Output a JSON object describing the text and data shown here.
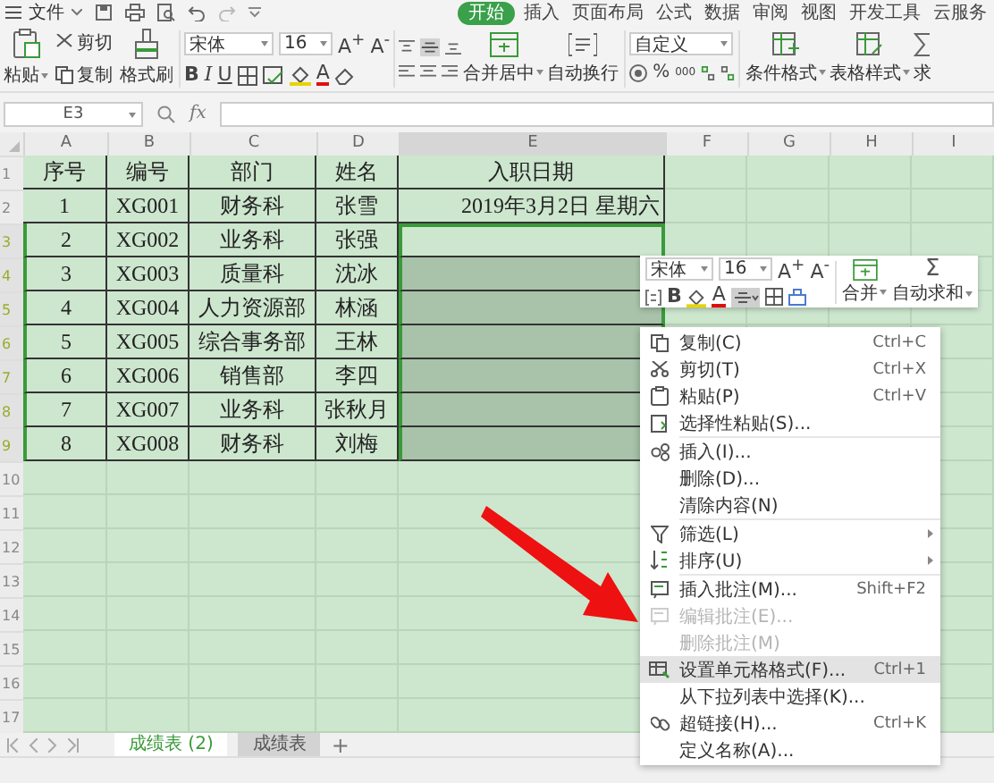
{
  "menu_bar": {
    "file": "文件",
    "tabs": [
      {
        "label": "开始",
        "selected": true
      },
      {
        "label": "插入",
        "selected": false
      },
      {
        "label": "页面布局",
        "selected": false
      },
      {
        "label": "公式",
        "selected": false
      },
      {
        "label": "数据",
        "selected": false
      },
      {
        "label": "审阅",
        "selected": false
      },
      {
        "label": "视图",
        "selected": false
      },
      {
        "label": "开发工具",
        "selected": false
      },
      {
        "label": "云服务",
        "selected": false
      }
    ]
  },
  "ribbon": {
    "paste": "粘贴",
    "cut": "剪切",
    "copy": "复制",
    "format_painter": "格式刷",
    "font": "宋体",
    "font_size": "16",
    "grow_font": "A$^{+}$",
    "shrink_font": "A$^{-}$",
    "bold": "B",
    "italic": "I",
    "underline": "U",
    "font_color": "A",
    "merge_center": "合并居中",
    "wrap_text": "自动换行",
    "number_format": "自定义",
    "percent": "%",
    "thousands": "000",
    "conditional_format": "条件格式",
    "table_style": "表格样式",
    "sum": "求"
  },
  "formula_bar": {
    "cell_ref": "E3",
    "fx": "fx"
  },
  "columns": [
    {
      "label": "A",
      "selected": false
    },
    {
      "label": "B",
      "selected": false
    },
    {
      "label": "C",
      "selected": false
    },
    {
      "label": "D",
      "selected": false
    },
    {
      "label": "E",
      "selected": true
    },
    {
      "label": "F",
      "selected": false
    },
    {
      "label": "G",
      "selected": false
    },
    {
      "label": "H",
      "selected": false
    },
    {
      "label": "I",
      "selected": false
    }
  ],
  "rows": [
    {
      "num": "1",
      "selected": false,
      "cells": [
        "序号",
        "编号",
        "部门",
        "姓名",
        "入职日期"
      ],
      "e_shaded": false
    },
    {
      "num": "2",
      "selected": false,
      "cells": [
        "1",
        "XG001",
        "财务科",
        "张雪",
        "2019年3月2日  星期六"
      ],
      "e_shaded": false
    },
    {
      "num": "3",
      "selected": true,
      "cells": [
        "2",
        "XG002",
        "业务科",
        "张强"
      ],
      "e_shaded": false
    },
    {
      "num": "4",
      "selected": true,
      "cells": [
        "3",
        "XG003",
        "质量科",
        "沈冰"
      ],
      "e_shaded": true
    },
    {
      "num": "5",
      "selected": true,
      "cells": [
        "4",
        "XG004",
        "人力资源部",
        "林涵"
      ],
      "e_shaded": true
    },
    {
      "num": "6",
      "selected": true,
      "cells": [
        "5",
        "XG005",
        "综合事务部",
        "王林"
      ],
      "e_shaded": true
    },
    {
      "num": "7",
      "selected": true,
      "cells": [
        "6",
        "XG006",
        "销售部",
        "李四"
      ],
      "e_shaded": true
    },
    {
      "num": "8",
      "selected": true,
      "cells": [
        "7",
        "XG007",
        "业务科",
        "张秋月"
      ],
      "e_shaded": true
    },
    {
      "num": "9",
      "selected": true,
      "cells": [
        "8",
        "XG008",
        "财务科",
        "刘梅"
      ],
      "e_shaded": true
    },
    {
      "num": "10",
      "selected": false,
      "cells": [],
      "e_shaded": false
    },
    {
      "num": "11",
      "selected": false,
      "cells": [],
      "e_shaded": false
    },
    {
      "num": "12",
      "selected": false,
      "cells": [],
      "e_shaded": false
    },
    {
      "num": "13",
      "selected": false,
      "cells": [],
      "e_shaded": false
    },
    {
      "num": "14",
      "selected": false,
      "cells": [],
      "e_shaded": false
    },
    {
      "num": "15",
      "selected": false,
      "cells": [],
      "e_shaded": false
    },
    {
      "num": "16",
      "selected": false,
      "cells": [],
      "e_shaded": false
    },
    {
      "num": "17",
      "selected": false,
      "cells": [],
      "e_shaded": false
    }
  ],
  "mini_toolbar": {
    "font": "宋体",
    "font_size": "16",
    "grow_font": "A$^{+}$",
    "shrink_font": "A$^{-}$",
    "bold": "B",
    "font_color": "A",
    "merge": "合并",
    "sigma": "Σ",
    "autosum": "自动求和"
  },
  "context_menu": [
    {
      "kind": "copy",
      "label": "复制(C)",
      "shortcut": "Ctrl+C",
      "disabled": false,
      "selected": false,
      "submenu": false
    },
    {
      "kind": "cut",
      "label": "剪切(T)",
      "shortcut": "Ctrl+X",
      "disabled": false,
      "selected": false,
      "submenu": false
    },
    {
      "kind": "paste",
      "label": "粘贴(P)",
      "shortcut": "Ctrl+V",
      "disabled": false,
      "selected": false,
      "submenu": false
    },
    {
      "kind": "paste-special",
      "label": "选择性粘贴(S)...",
      "disabled": false,
      "selected": false,
      "submenu": false,
      "divider_after": true
    },
    {
      "kind": "insert",
      "label": "插入(I)...",
      "disabled": false,
      "selected": false,
      "submenu": false
    },
    {
      "kind": "none",
      "label": "删除(D)...",
      "disabled": false,
      "selected": false,
      "submenu": false
    },
    {
      "kind": "none",
      "label": "清除内容(N)",
      "disabled": false,
      "selected": false,
      "submenu": false,
      "divider_after": true
    },
    {
      "kind": "filter",
      "label": "筛选(L)",
      "disabled": false,
      "selected": false,
      "submenu": true
    },
    {
      "kind": "sort",
      "label": "排序(U)",
      "disabled": false,
      "selected": false,
      "submenu": true,
      "divider_after": true
    },
    {
      "kind": "comment",
      "label": "插入批注(M)...",
      "shortcut": "Shift+F2",
      "disabled": false,
      "selected": false,
      "submenu": false
    },
    {
      "kind": "comment",
      "label": "编辑批注(E)...",
      "disabled": true,
      "selected": false,
      "submenu": false
    },
    {
      "kind": "none",
      "label": "删除批注(M)",
      "disabled": true,
      "selected": false,
      "submenu": false
    },
    {
      "kind": "format",
      "label": "设置单元格格式(F)...",
      "shortcut": "Ctrl+1",
      "disabled": false,
      "selected": true,
      "submenu": false
    },
    {
      "kind": "none",
      "label": "从下拉列表中选择(K)...",
      "disabled": false,
      "selected": false,
      "submenu": false
    },
    {
      "kind": "link",
      "label": "超链接(H)...",
      "shortcut": "Ctrl+K",
      "disabled": false,
      "selected": false,
      "submenu": false
    },
    {
      "kind": "none",
      "label": "定义名称(A)...",
      "disabled": false,
      "selected": false,
      "submenu": false
    }
  ],
  "sheet_tabs": {
    "tabs": [
      {
        "label": "成绩表 (2)",
        "selected": true
      },
      {
        "label": "成绩表",
        "selected": false
      }
    ],
    "add": "+"
  }
}
